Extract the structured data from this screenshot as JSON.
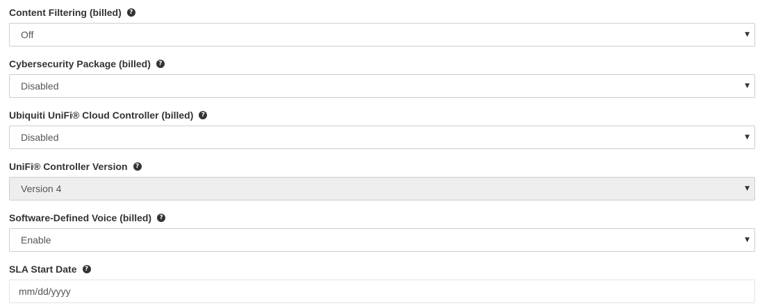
{
  "fields": [
    {
      "label": "Content Filtering (billed)",
      "value": "Off",
      "type": "select",
      "disabled": false
    },
    {
      "label": "Cybersecurity Package (billed)",
      "value": "Disabled",
      "type": "select",
      "disabled": false
    },
    {
      "label": "Ubiquiti UniFi® Cloud Controller (billed)",
      "value": "Disabled",
      "type": "select",
      "disabled": false
    },
    {
      "label": "UniFi® Controller Version",
      "value": "Version 4",
      "type": "select",
      "disabled": true
    },
    {
      "label": "Software-Defined Voice (billed)",
      "value": "Enable",
      "type": "select",
      "disabled": false
    },
    {
      "label": "SLA Start Date",
      "placeholder": "mm/dd/yyyy",
      "type": "date",
      "disabled": false
    }
  ],
  "icons": {
    "help": "question-circle-icon",
    "caret": "caret-down-icon"
  },
  "colors": {
    "label_text": "#333333",
    "control_border": "#cccccc",
    "disabled_background": "#eeeeee"
  }
}
